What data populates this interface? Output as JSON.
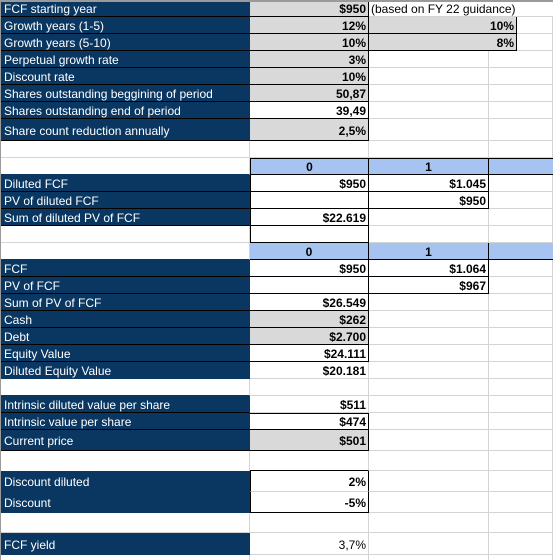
{
  "assumptions": {
    "fcf_starting_year": {
      "label": "FCF starting year",
      "value": "$950",
      "note": "(based on FY 22 guidance)"
    },
    "growth_1_5": {
      "label": "Growth years (1-5)",
      "value": "12%",
      "value2": "10%"
    },
    "growth_5_10": {
      "label": "Growth years (5-10)",
      "value": "10%",
      "value2": "8%"
    },
    "perpetual_growth": {
      "label": "Perpetual growth rate",
      "value": "3%"
    },
    "discount_rate": {
      "label": "Discount rate",
      "value": "10%"
    },
    "shares_begin": {
      "label": "Shares outstanding beggining of period",
      "value": "50,87"
    },
    "shares_end": {
      "label": "Shares outstanding end of period",
      "value": "39,49"
    },
    "share_reduction": {
      "label": "Share count reduction annually",
      "value": "2,5%"
    }
  },
  "diluted": {
    "period_headers": [
      "0",
      "1"
    ],
    "diluted_fcf": {
      "label": "Diluted FCF",
      "values": [
        "$950",
        "$1.045"
      ]
    },
    "pv_diluted_fcf": {
      "label": "PV of  diluted FCF",
      "values": [
        "",
        "$950"
      ]
    },
    "sum_diluted_pv": {
      "label": "Sum of diluted PV of FCF",
      "value": "$22.619"
    }
  },
  "standard": {
    "period_headers": [
      "0",
      "1"
    ],
    "fcf": {
      "label": "FCF",
      "values": [
        "$950",
        "$1.064"
      ]
    },
    "pv_fcf": {
      "label": "PV of FCF",
      "values": [
        "",
        "$967"
      ]
    },
    "sum_pv_fcf": {
      "label": "Sum of PV of FCF",
      "value": "$26.549"
    },
    "cash": {
      "label": "Cash",
      "value": "$262"
    },
    "debt": {
      "label": "Debt",
      "value": "$2.700"
    },
    "equity_value": {
      "label": "Equity Value",
      "value": "$24.111"
    },
    "diluted_equity_value": {
      "label": "Diluted Equity Value",
      "value": "$20.181"
    }
  },
  "valuation": {
    "intrinsic_diluted": {
      "label": "Intrinsic diluted value per share",
      "value": "$511"
    },
    "intrinsic": {
      "label": "Intrinsic value per share",
      "value": "$474"
    },
    "current_price": {
      "label": "Current price",
      "value": "$501"
    }
  },
  "discounts": {
    "discount_diluted": {
      "label": "Discount diluted",
      "value": "2%"
    },
    "discount": {
      "label": "Discount",
      "value": "-5%"
    }
  },
  "yield": {
    "fcf_yield": {
      "label": "FCF yield",
      "value": "3,7%"
    }
  },
  "colors": {
    "label_bg": "#0a3761",
    "input_bg": "#d9d9d9",
    "header_bg": "#a6c4ef",
    "grid": "#d4d4d4"
  }
}
